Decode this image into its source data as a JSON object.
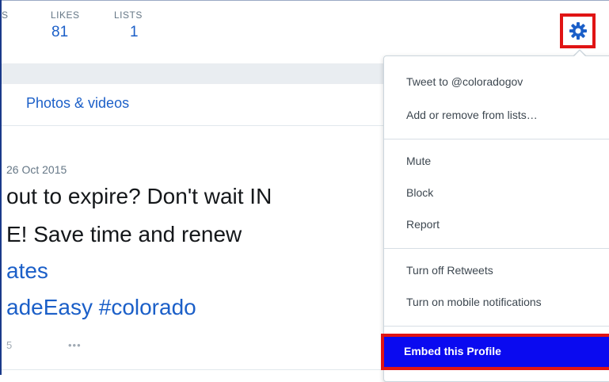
{
  "profile_stats": {
    "cut_label": "S",
    "likes": {
      "label": "LIKES",
      "value": "81"
    },
    "lists": {
      "label": "LISTS",
      "value": "1"
    }
  },
  "settings": {
    "icon": "gear-icon",
    "highlight_color": "#e01414"
  },
  "tabs": {
    "photos_videos": "Photos & videos"
  },
  "tweet": {
    "date": "26 Oct 2015",
    "line1": "out to expire? Don't wait IN",
    "line2": "E! Save time and renew",
    "link1": "ates",
    "link2": "adeEasy #colorado",
    "footer_count": "5",
    "more": "•••"
  },
  "menu": {
    "items": [
      "Tweet to @coloradogov",
      "Add or remove from lists…",
      "Mute",
      "Block",
      "Report",
      "Turn off Retweets",
      "Turn on mobile notifications"
    ],
    "highlighted": "Embed this Profile",
    "highlight_bg": "#0a0af0"
  }
}
